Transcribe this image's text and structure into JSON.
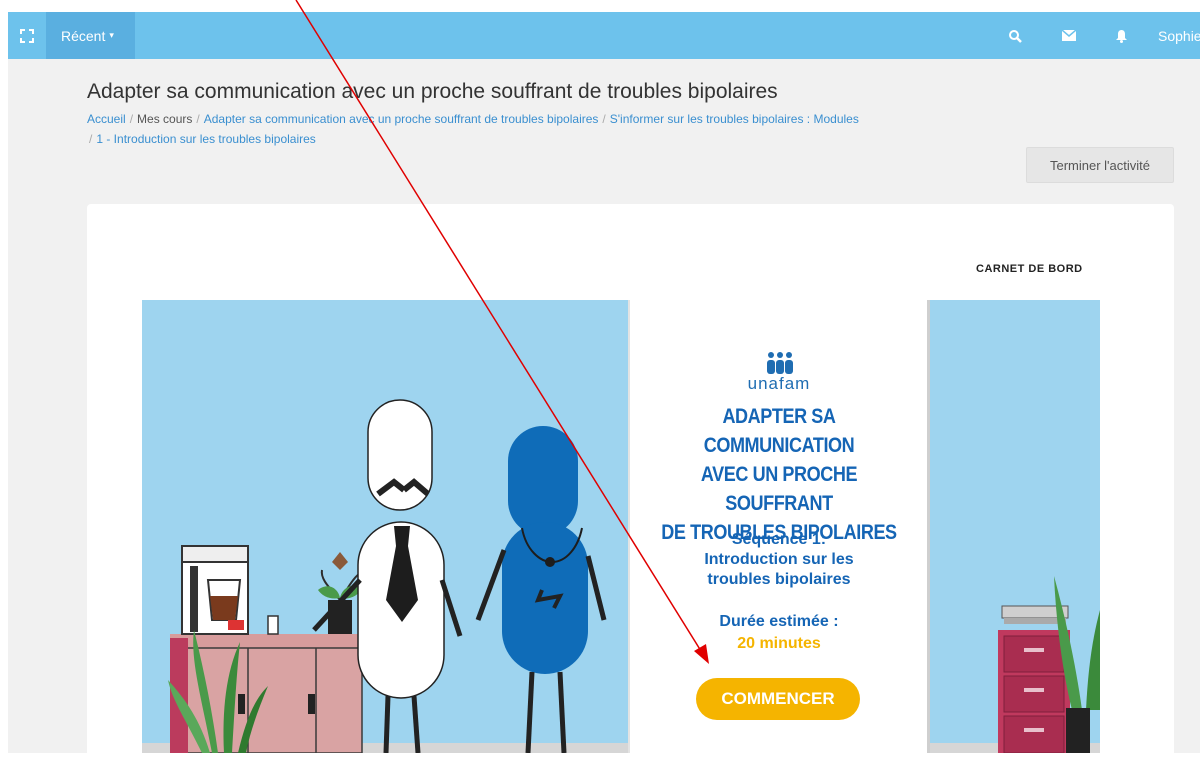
{
  "navbar": {
    "expand_icon": "expand-icon",
    "recent_label": "Récent",
    "recent_caret": "▾",
    "search_icon": "search-icon",
    "mail_icon": "envelope-icon",
    "bell_icon": "bell-icon",
    "user_name": "Sophie"
  },
  "header": {
    "title": "Adapter sa communication avec un proche souffrant de troubles bipolaires",
    "breadcrumb": [
      "Accueil",
      "Mes cours",
      "Adapter sa communication avec un proche souffrant de troubles bipolaires",
      "S'informer sur les troubles bipolaires : Modules",
      "1 - Introduction sur les troubles bipolaires"
    ],
    "separator": "/",
    "finish_button": "Terminer l'activité"
  },
  "content": {
    "carnet_label": "CARNET DE BORD",
    "brand": "unafam",
    "course_title_lines": [
      "ADAPTER SA COMMUNICATION",
      "AVEC UN PROCHE SOUFFRANT",
      "DE TROUBLES BIPOLAIRES"
    ],
    "sequence_lines": [
      "Séquence 1:",
      "Introduction sur les",
      "troubles bipolaires"
    ],
    "duration_label": "Durée estimée :",
    "duration_value": "20 minutes",
    "start_button": "COMMENCER"
  },
  "colors": {
    "navbar": "#6dc2ec",
    "recent_tab": "#5aafe0",
    "scene_bg": "#9ed4ef",
    "title_blue": "#1565b5",
    "accent_yellow": "#f5b400",
    "annotation_arrow": "#e00000"
  }
}
